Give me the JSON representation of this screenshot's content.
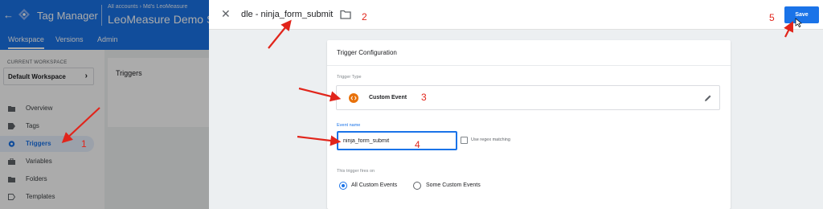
{
  "app": {
    "product_name": "Tag Manager",
    "account_path": "All accounts › Md's LeoMeasure",
    "container_name": "LeoMeasure Demo Site",
    "nav_tabs": [
      "Workspace",
      "Versions",
      "Admin"
    ]
  },
  "sidebar": {
    "workspace_label": "CURRENT WORKSPACE",
    "workspace_name": "Default Workspace",
    "items": [
      {
        "label": "Overview",
        "icon": "folder-icon"
      },
      {
        "label": "Tags",
        "icon": "tag-icon"
      },
      {
        "label": "Triggers",
        "icon": "trigger-icon",
        "active": true
      },
      {
        "label": "Variables",
        "icon": "briefcase-icon"
      },
      {
        "label": "Folders",
        "icon": "folder-icon"
      },
      {
        "label": "Templates",
        "icon": "template-icon"
      }
    ]
  },
  "content": {
    "title": "Triggers"
  },
  "panel": {
    "trigger_name": "dle - ninja_form_submit",
    "save_label": "Save",
    "card_title": "Trigger Configuration",
    "trigger_type_label": "Trigger Type",
    "trigger_type": "Custom Event",
    "event_name_label": "Event name",
    "event_name_value": "ninja_form_submit",
    "regex_label": "Use regex matching",
    "fires_on_label": "This trigger fires on",
    "fire_options": [
      "All Custom Events",
      "Some Custom Events"
    ],
    "selected_option": "All Custom Events"
  },
  "annotations": [
    "1",
    "2",
    "3",
    "4",
    "5"
  ],
  "colors": {
    "brand_blue": "#1a73e8",
    "annotation_red": "#e1251b",
    "custom_event_orange": "#e8710a"
  }
}
